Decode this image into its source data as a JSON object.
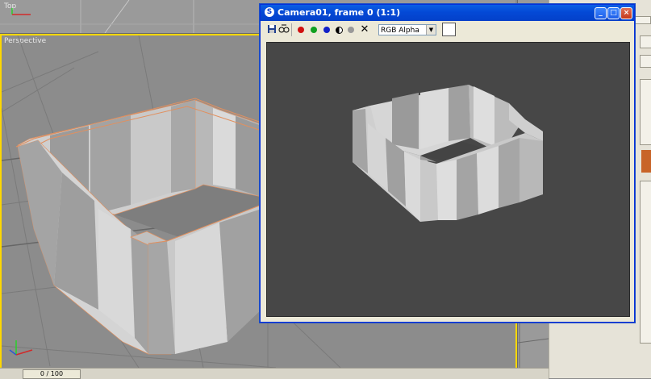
{
  "viewports": {
    "top_label": "Top",
    "perspective_label": "Perspective"
  },
  "render_window": {
    "title": "Camera01, frame 0 (1:1)",
    "title_icon": "max-logo-icon",
    "controls": [
      "minimize",
      "maximize",
      "close"
    ],
    "toolbar": {
      "icons": [
        "save-icon",
        "clone-icon",
        "red-channel-icon",
        "green-channel-icon",
        "blue-channel-icon",
        "monochrome-icon",
        "alpha-icon",
        "clear-icon"
      ],
      "channel_select_value": "RGB Alpha",
      "swatch_color": "#ffffff"
    },
    "background_color": "#474747"
  },
  "timeline": {
    "slider_label": "0 / 100"
  },
  "colors": {
    "active_viewport_border": "#ffd800",
    "titlebar_blue": "#0449d6",
    "object_light": "#d2d2d2",
    "object_dark": "#9a9a9a",
    "edge_highlight": "#f0a060"
  }
}
